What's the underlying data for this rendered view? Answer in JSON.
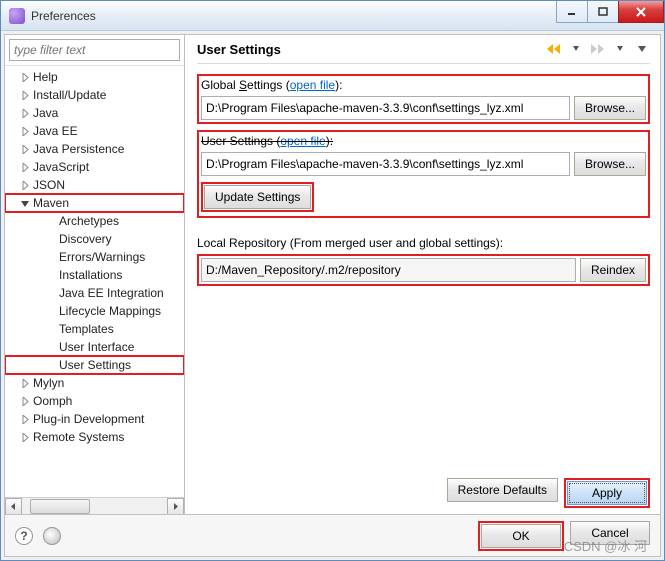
{
  "window": {
    "title": "Preferences"
  },
  "filter": {
    "placeholder": "type filter text"
  },
  "tree": [
    {
      "label": "Help",
      "level": 1,
      "arrow": "right"
    },
    {
      "label": "Install/Update",
      "level": 1,
      "arrow": "right"
    },
    {
      "label": "Java",
      "level": 1,
      "arrow": "right"
    },
    {
      "label": "Java EE",
      "level": 1,
      "arrow": "right"
    },
    {
      "label": "Java Persistence",
      "level": 1,
      "arrow": "right"
    },
    {
      "label": "JavaScript",
      "level": 1,
      "arrow": "right"
    },
    {
      "label": "JSON",
      "level": 1,
      "arrow": "right"
    },
    {
      "label": "Maven",
      "level": 1,
      "arrow": "down",
      "hl": true
    },
    {
      "label": "Archetypes",
      "level": 2
    },
    {
      "label": "Discovery",
      "level": 2
    },
    {
      "label": "Errors/Warnings",
      "level": 2
    },
    {
      "label": "Installations",
      "level": 2
    },
    {
      "label": "Java EE Integration",
      "level": 2
    },
    {
      "label": "Lifecycle Mappings",
      "level": 2
    },
    {
      "label": "Templates",
      "level": 2
    },
    {
      "label": "User Interface",
      "level": 2
    },
    {
      "label": "User Settings",
      "level": 2,
      "hl": true
    },
    {
      "label": "Mylyn",
      "level": 1,
      "arrow": "right"
    },
    {
      "label": "Oomph",
      "level": 1,
      "arrow": "right"
    },
    {
      "label": "Plug-in Development",
      "level": 1,
      "arrow": "right"
    },
    {
      "label": "Remote Systems",
      "level": 1,
      "arrow": "right"
    }
  ],
  "page": {
    "title": "User Settings",
    "global": {
      "label_pre": "Global ",
      "label_u": "S",
      "label_post": "ettings (",
      "link": "open file",
      "label_end": "):",
      "value": "D:\\Program Files\\apache-maven-3.3.9\\conf\\settings_lyz.xml",
      "browse": "Browse..."
    },
    "user": {
      "label_pre": "User Settings (",
      "link": "open file",
      "label_end": "):",
      "value": "D:\\Program Files\\apache-maven-3.3.9\\conf\\settings_lyz.xml",
      "browse": "Browse..."
    },
    "update": "Update Settings",
    "repo": {
      "label": "Local Repository (From merged user and global settings):",
      "value": "D:/Maven_Repository/.m2/repository",
      "reindex_u": "R",
      "reindex_post": "eindex"
    },
    "restore": "Restore ",
    "restore_u": "D",
    "restore_post": "efaults",
    "apply": "Apply"
  },
  "footer": {
    "ok": "OK",
    "cancel": "Cancel"
  },
  "watermark": "CSDN @冰 河"
}
